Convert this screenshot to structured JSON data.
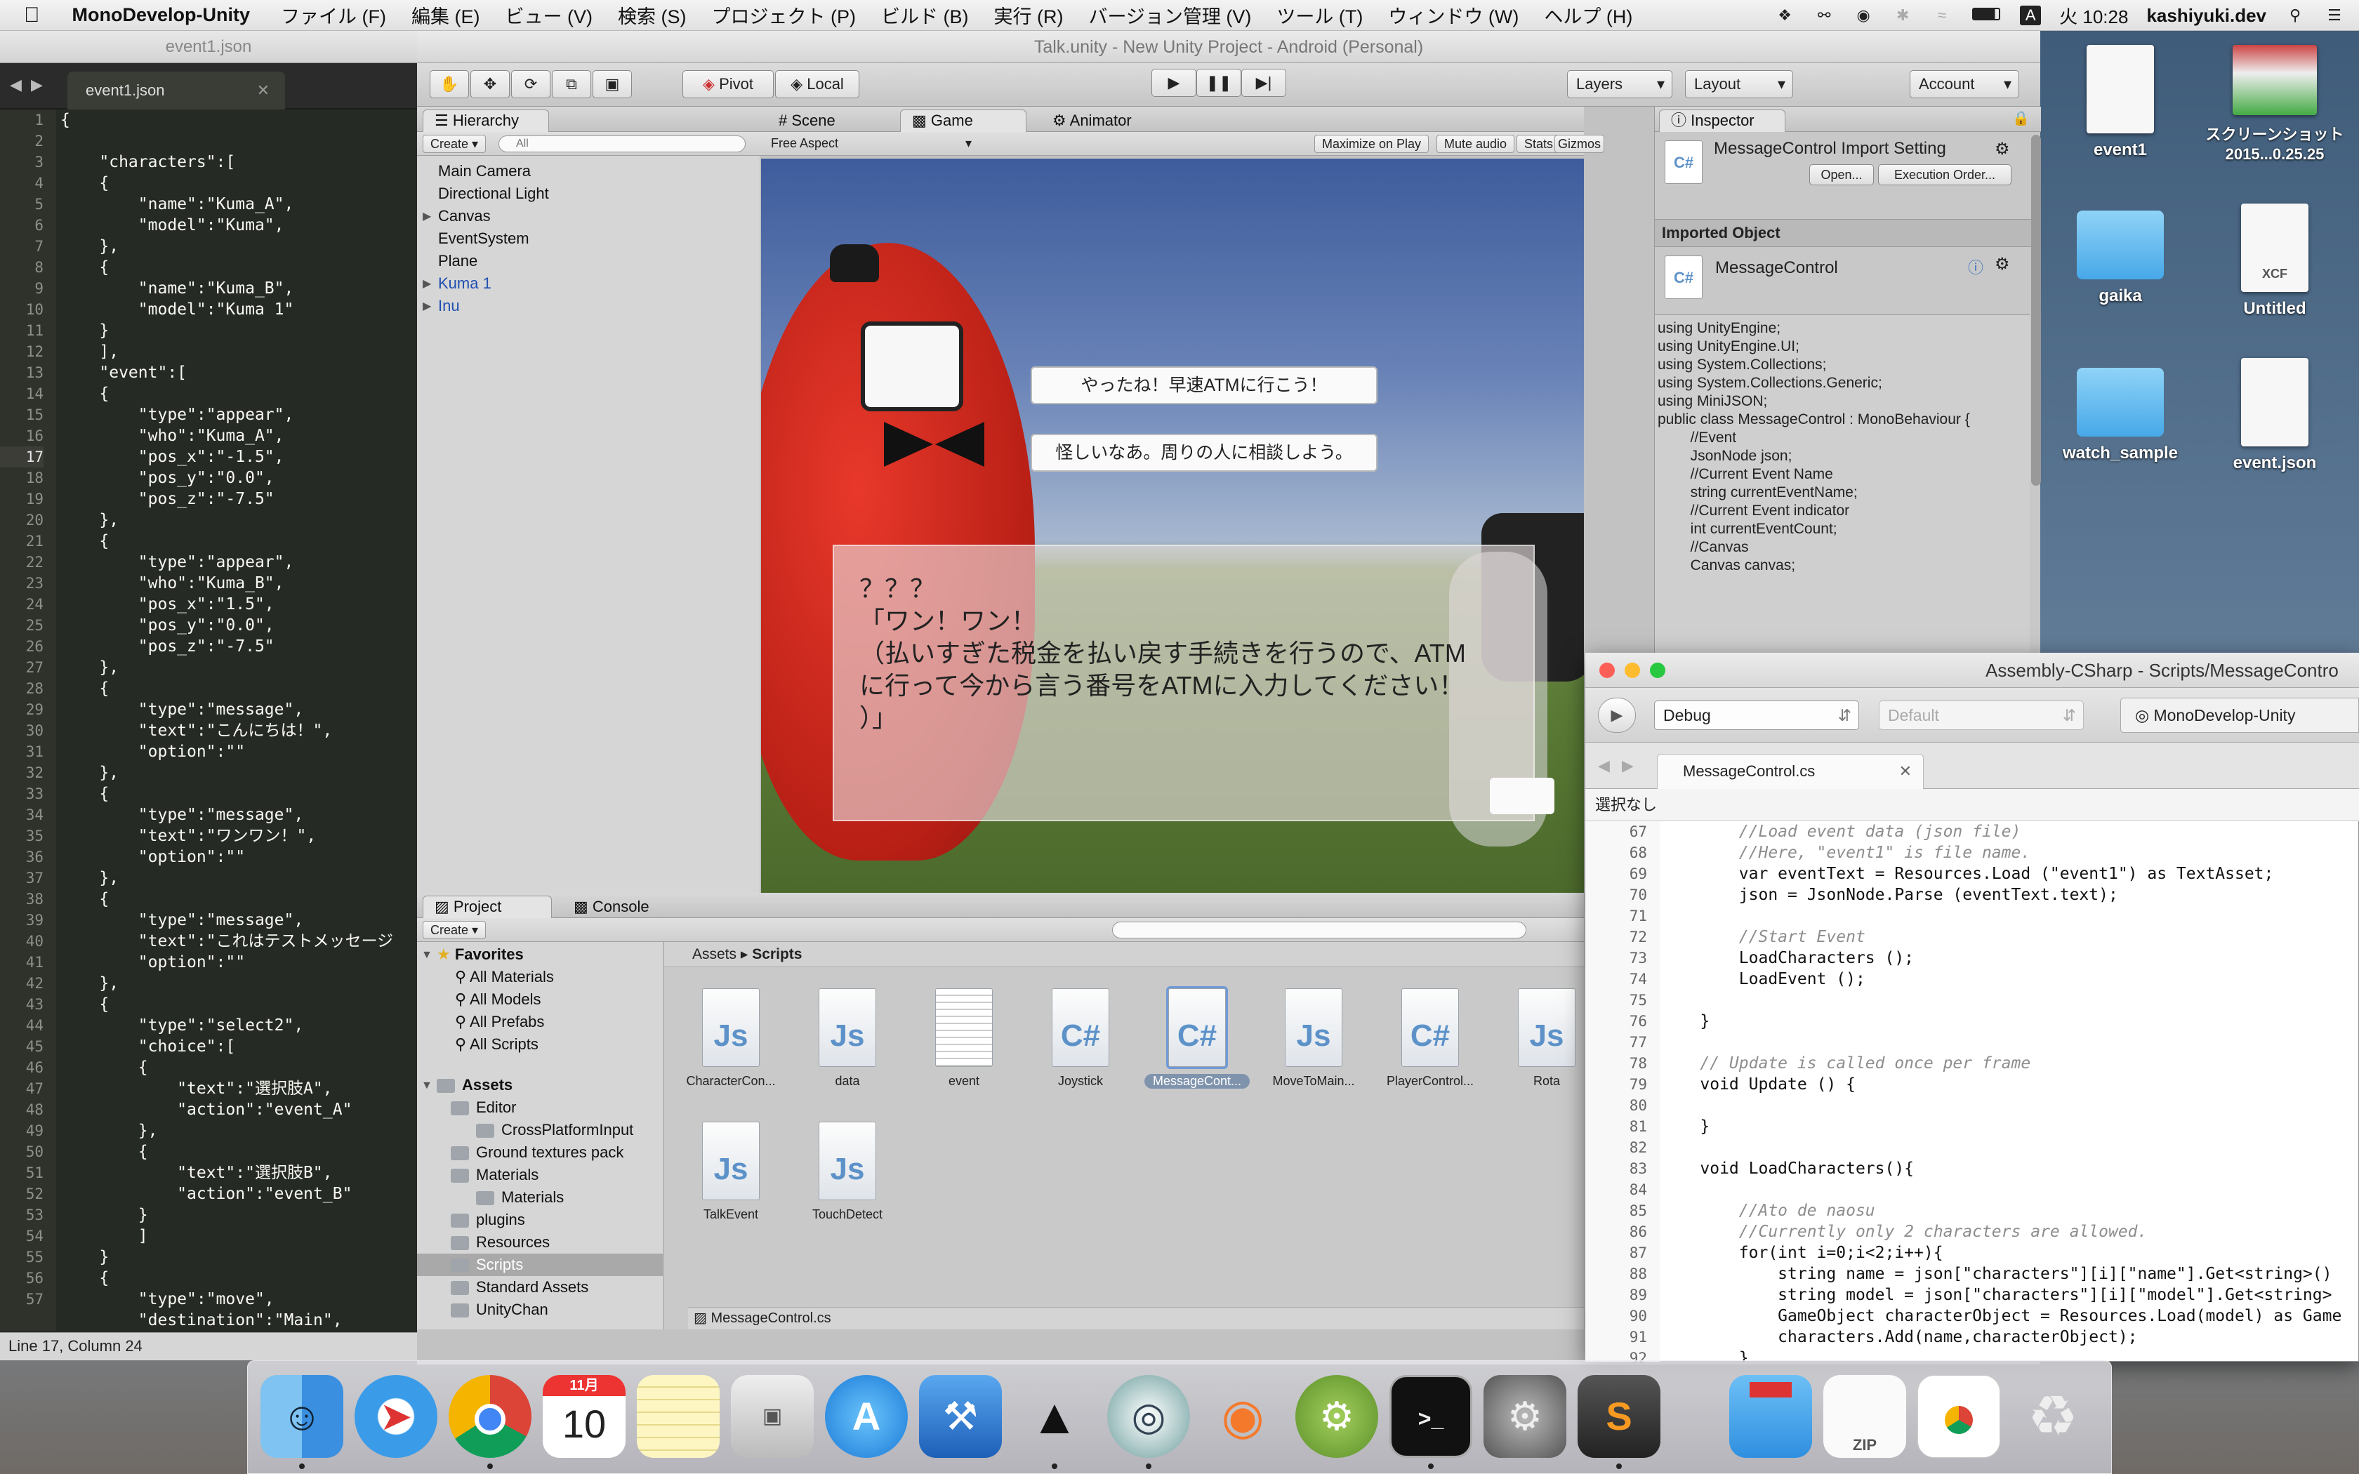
{
  "menubar": {
    "app_name": "MonoDevelop-Unity",
    "items": [
      "ファイル (F)",
      "編集 (E)",
      "ビュー (V)",
      "検索 (S)",
      "プロジェクト (P)",
      "ビルド (B)",
      "実行 (R)",
      "バージョン管理 (V)",
      "ツール (T)",
      "ウィンドウ (W)",
      "ヘルプ (H)"
    ],
    "input_source": "A",
    "clock": "火 10:28",
    "user": "kashiyuki.dev"
  },
  "editor": {
    "window_title": "event1.json",
    "tab_label": "event1.json",
    "status": "Line 17, Column 24",
    "line_numbers": [
      "1",
      "2",
      "3",
      "4",
      "5",
      "6",
      "7",
      "8",
      "9",
      "10",
      "11",
      "12",
      "13",
      "14",
      "15",
      "16",
      "17",
      "18",
      "19",
      "20",
      "21",
      "22",
      "23",
      "24",
      "25",
      "26",
      "27",
      "28",
      "29",
      "30",
      "31",
      "32",
      "33",
      "34",
      "35",
      "36",
      "37",
      "38",
      "39",
      "40",
      "41",
      "42",
      "43",
      "44",
      "45",
      "46",
      "47",
      "48",
      "49",
      "50",
      "51",
      "52",
      "53",
      "54",
      "55",
      "56",
      "57"
    ],
    "lines": [
      "{",
      "",
      "    \"characters\":[",
      "    {",
      "        \"name\":\"Kuma_A\",",
      "        \"model\":\"Kuma\",",
      "    },",
      "    {",
      "        \"name\":\"Kuma_B\",",
      "        \"model\":\"Kuma 1\"",
      "    }",
      "    ],",
      "    \"event\":[",
      "    {",
      "        \"type\":\"appear\",",
      "        \"who\":\"Kuma_A\",",
      "        \"pos_x\":\"-1.5\",",
      "        \"pos_y\":\"0.0\",",
      "        \"pos_z\":\"-7.5\"",
      "    },",
      "    {",
      "        \"type\":\"appear\",",
      "        \"who\":\"Kuma_B\",",
      "        \"pos_x\":\"1.5\",",
      "        \"pos_y\":\"0.0\",",
      "        \"pos_z\":\"-7.5\"",
      "    },",
      "    {",
      "        \"type\":\"message\",",
      "        \"text\":\"こんにちは！\",",
      "        \"option\":\"\"",
      "    },",
      "    {",
      "        \"type\":\"message\",",
      "        \"text\":\"ワンワン！\",",
      "        \"option\":\"\"",
      "    },",
      "    {",
      "        \"type\":\"message\",",
      "        \"text\":\"これはテストメッセージ",
      "        \"option\":\"\"",
      "    },",
      "    {",
      "        \"type\":\"select2\",",
      "        \"choice\":[",
      "        {",
      "            \"text\":\"選択肢A\",",
      "            \"action\":\"event_A\"",
      "        },",
      "        {",
      "            \"text\":\"選択肢B\",",
      "            \"action\":\"event_B\"",
      "        }",
      "        ]",
      "    }",
      "    {",
      "        \"type\":\"move\",",
      "        \"destination\":\"Main\","
    ]
  },
  "unity": {
    "window_title": "Talk.unity - New Unity Project - Android (Personal)",
    "pivot": "Pivot",
    "local": "Local",
    "layers": "Layers",
    "layout": "Layout",
    "account": "Account",
    "hierarchy": {
      "tab": "Hierarchy",
      "create": "Create",
      "search_placeholder": "All",
      "items": [
        "Main Camera",
        "Directional Light",
        "Canvas",
        "EventSystem",
        "Plane",
        "Kuma 1",
        "Inu"
      ]
    },
    "scene_tabs": [
      "Scene",
      "Game",
      "Animator"
    ],
    "game_bar": {
      "aspect": "Free Aspect",
      "buttons": [
        "Maximize on Play",
        "Mute audio",
        "Stats",
        "Gizmos"
      ]
    },
    "game": {
      "choice_a": "やったね！早速ATMに行こう！",
      "choice_b": "怪しいなあ。周りの人に相談しよう。",
      "message_lines": [
        "？？？",
        "「ワン！ワン！",
        "（払いすぎた税金を払い戻す手続きを行うので、ATM",
        "に行って今から言う番号をATMに入力してください！",
        "）」"
      ]
    },
    "inspector": {
      "tab": "Inspector",
      "title": "MessageControl Import Setting",
      "open_btn": "Open...",
      "exec_btn": "Execution Order...",
      "imported_header": "Imported Object",
      "imported_name": "MessageControl",
      "code": [
        "using UnityEngine;",
        "using UnityEngine.UI;",
        "using System.Collections;",
        "using System.Collections.Generic;",
        "using MiniJSON;",
        "",
        "public class MessageControl : MonoBehaviour {",
        "",
        "        //Event",
        "        JsonNode json;",
        "",
        "        //Current Event Name",
        "        string currentEventName;",
        "",
        "        //Current Event indicator",
        "        int currentEventCount;",
        "",
        "        //Canvas",
        "        Canvas canvas;"
      ]
    },
    "project": {
      "tabs": [
        "Project",
        "Console"
      ],
      "create": "Create",
      "favorites_label": "Favorites",
      "favorites": [
        "All Materials",
        "All Models",
        "All Prefabs",
        "All Scripts"
      ],
      "assets_label": "Assets",
      "tree": [
        "Editor",
        "CrossPlatformInput",
        "Ground textures pack",
        "Materials",
        "Materials",
        "plugins",
        "Resources",
        "Scripts",
        "Standard Assets",
        "UnityChan"
      ],
      "breadcrumb_root": "Assets",
      "breadcrumb_leaf": "Scripts",
      "assets": [
        {
          "name": "CharacterCon...",
          "kind": "Js"
        },
        {
          "name": "data",
          "kind": "Js"
        },
        {
          "name": "event",
          "kind": "txt"
        },
        {
          "name": "Joystick",
          "kind": "C#"
        },
        {
          "name": "MessageCont...",
          "kind": "C#"
        },
        {
          "name": "MoveToMain...",
          "kind": "Js"
        },
        {
          "name": "PlayerControl...",
          "kind": "C#"
        },
        {
          "name": "Rota",
          "kind": "Js"
        },
        {
          "name": "TalkEvent",
          "kind": "Js"
        },
        {
          "name": "TouchDetect",
          "kind": "Js"
        }
      ],
      "selected_file": "MessageControl.cs"
    }
  },
  "monodevelop": {
    "title": "Assembly-CSharp - Scripts/MessageContro",
    "config": "Debug",
    "target": "Default",
    "app": "MonoDevelop-Unity",
    "tab": "MessageControl.cs",
    "breadcrumb": "選択なし",
    "line_numbers": [
      "67",
      "68",
      "69",
      "70",
      "71",
      "72",
      "73",
      "74",
      "75",
      "76",
      "77",
      "78",
      "79",
      "80",
      "81",
      "82",
      "83",
      "84",
      "85",
      "86",
      "87",
      "88",
      "89",
      "90",
      "91",
      "92"
    ],
    "lines": [
      "        //Load event data (json file)",
      "        //Here, \"event1\" is file name.",
      "        var eventText = Resources.Load (\"event1\") as TextAsset;",
      "        json = JsonNode.Parse (eventText.text);",
      "",
      "        //Start Event",
      "        LoadCharacters ();",
      "        LoadEvent ();",
      "",
      "    }",
      "",
      "    // Update is called once per frame",
      "    void Update () {",
      "",
      "    }",
      "",
      "    void LoadCharacters(){",
      "",
      "        //Ato de naosu",
      "        //Currently only 2 characters are allowed.",
      "        for(int i=0;i<2;i++){",
      "            string name = json[\"characters\"][i][\"name\"].Get<string>()",
      "            string model = json[\"characters\"][i][\"model\"].Get<string>",
      "            GameObject characterObject = Resources.Load(model) as Game",
      "            characters.Add(name,characterObject);",
      "        }"
    ]
  },
  "desktop": {
    "icons": [
      {
        "label": "event1",
        "kind": "file"
      },
      {
        "label": "スクリーンショット 2015...0.25.25",
        "kind": "image"
      },
      {
        "label": "gaika",
        "kind": "folder"
      },
      {
        "label": "Untitled",
        "kind": "xcf"
      },
      {
        "label": "watch_sample",
        "kind": "folder"
      },
      {
        "label": "event.json",
        "kind": "file"
      }
    ],
    "xcf_badge": "XCF"
  },
  "dock": {
    "apps": [
      "Finder",
      "Safari",
      "Chrome",
      "Calendar",
      "Notes",
      "Preview",
      "App Store",
      "Xcode",
      "Unity",
      "MonoDevelop",
      "Blender",
      "Android Studio",
      "Terminal",
      "System Preferences",
      "Sublime Text",
      "Downloads",
      "Archive",
      "Document",
      "Trash"
    ],
    "calendar_month": "11月",
    "calendar_day": "10",
    "zip_label": "ZIP"
  },
  "colors": {
    "editor_bg": "#262a24",
    "game_sky": "#3e5c9c",
    "bear_red": "#d3251b",
    "selection_blue": "#3e7de0"
  }
}
